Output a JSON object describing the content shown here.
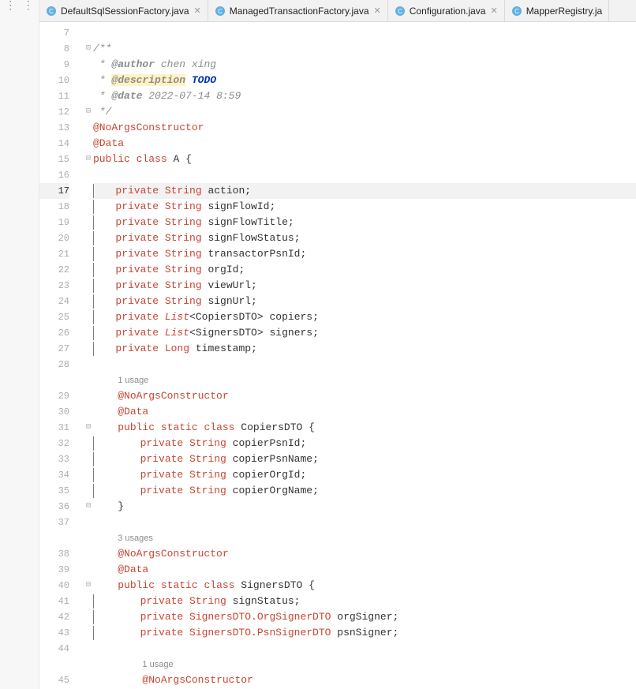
{
  "tabs": [
    {
      "label": "DefaultSqlSessionFactory.java",
      "active": false
    },
    {
      "label": "ManagedTransactionFactory.java",
      "active": false
    },
    {
      "label": "Configuration.java",
      "active": false
    },
    {
      "label": "MapperRegistry.ja",
      "active": false
    }
  ],
  "doc": {
    "author_tag": "@author",
    "author_val": "chen xing",
    "desc_tag": "@description",
    "desc_val": "TODO",
    "date_tag": "@date",
    "date_val": "2022-07-14 8:59"
  },
  "ann": {
    "noargs": "@NoArgsConstructor",
    "data": "@Data"
  },
  "class_decl": {
    "kw1": "public",
    "kw2": "class",
    "name": "A",
    "brace": "{"
  },
  "fields": {
    "f1": {
      "mod": "private",
      "type": "String",
      "name": "action;"
    },
    "f2": {
      "mod": "private",
      "type": "String",
      "name": "signFlowId;"
    },
    "f3": {
      "mod": "private",
      "type": "String",
      "name": "signFlowTitle;"
    },
    "f4": {
      "mod": "private",
      "type": "String",
      "name": "signFlowStatus;"
    },
    "f5": {
      "mod": "private",
      "type": "String",
      "name": "transactorPsnId;"
    },
    "f6": {
      "mod": "private",
      "type": "String",
      "name": "orgId;"
    },
    "f7": {
      "mod": "private",
      "type": "String",
      "name": "viewUrl;"
    },
    "f8": {
      "mod": "private",
      "type": "String",
      "name": "signUrl;"
    },
    "f9": {
      "mod": "private",
      "type": "List",
      "gen": "<CopiersDTO>",
      "name": "copiers;"
    },
    "f10": {
      "mod": "private",
      "type": "List",
      "gen": "<SignersDTO>",
      "name": "signers;"
    },
    "f11": {
      "mod": "private",
      "type": "Long",
      "name": "timestamp;"
    }
  },
  "hints": {
    "one": "1 usage",
    "three": "3 usages"
  },
  "inner1": {
    "decl": {
      "kw1": "public",
      "kw2": "static",
      "kw3": "class",
      "name": "CopiersDTO",
      "brace": "{"
    },
    "f1": {
      "mod": "private",
      "type": "String",
      "name": "copierPsnId;"
    },
    "f2": {
      "mod": "private",
      "type": "String",
      "name": "copierPsnName;"
    },
    "f3": {
      "mod": "private",
      "type": "String",
      "name": "copierOrgId;"
    },
    "f4": {
      "mod": "private",
      "type": "String",
      "name": "copierOrgName;"
    },
    "close": "}"
  },
  "inner2": {
    "decl": {
      "kw1": "public",
      "kw2": "static",
      "kw3": "class",
      "name": "SignersDTO",
      "brace": "{"
    },
    "f1": {
      "mod": "private",
      "type": "String",
      "name": "signStatus;"
    },
    "f2": {
      "mod": "private",
      "type": "SignersDTO.OrgSignerDTO",
      "name": "orgSigner;"
    },
    "f3": {
      "mod": "private",
      "type": "SignersDTO.PsnSignerDTO",
      "name": "psnSigner;"
    }
  },
  "line_numbers": [
    "7",
    "8",
    "9",
    "10",
    "11",
    "12",
    "13",
    "14",
    "15",
    "16",
    "17",
    "18",
    "19",
    "20",
    "21",
    "22",
    "23",
    "24",
    "25",
    "26",
    "27",
    "28",
    "",
    "29",
    "30",
    "31",
    "32",
    "33",
    "34",
    "35",
    "36",
    "37",
    "",
    "38",
    "39",
    "40",
    "41",
    "42",
    "43",
    "44",
    "",
    "45"
  ],
  "current_line_index": 10
}
